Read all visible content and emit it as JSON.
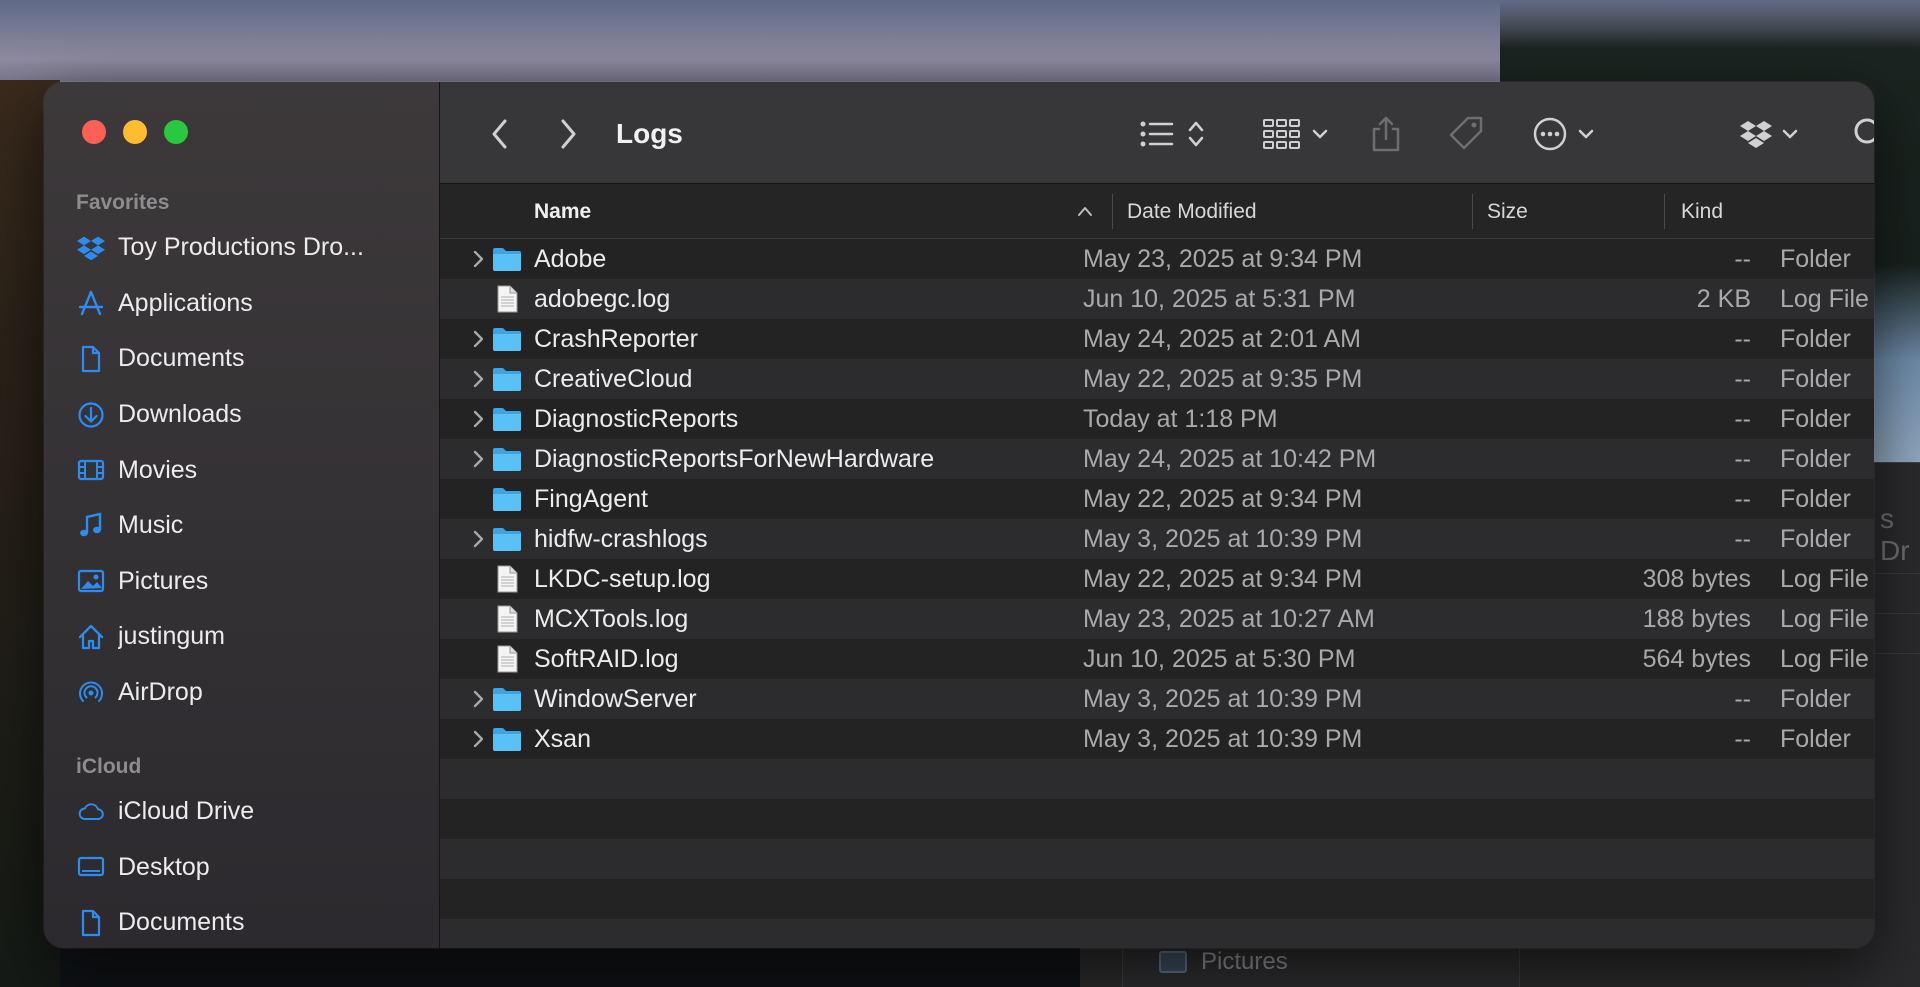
{
  "window": {
    "title": "Logs"
  },
  "sidebar": {
    "favorites_heading": "Favorites",
    "favorites": [
      {
        "label": "Toy Productions Dro...",
        "icon": "dropbox-icon"
      },
      {
        "label": "Applications",
        "icon": "applications-icon"
      },
      {
        "label": "Documents",
        "icon": "document-icon"
      },
      {
        "label": "Downloads",
        "icon": "download-icon"
      },
      {
        "label": "Movies",
        "icon": "film-icon"
      },
      {
        "label": "Music",
        "icon": "music-note-icon"
      },
      {
        "label": "Pictures",
        "icon": "picture-icon"
      },
      {
        "label": "justingum",
        "icon": "home-icon"
      },
      {
        "label": "AirDrop",
        "icon": "airdrop-icon"
      }
    ],
    "icloud_heading": "iCloud",
    "icloud": [
      {
        "label": "iCloud Drive",
        "icon": "cloud-icon"
      },
      {
        "label": "Desktop",
        "icon": "desktop-icon"
      },
      {
        "label": "Documents",
        "icon": "document-icon"
      }
    ]
  },
  "columns": {
    "name": "Name",
    "date_modified": "Date Modified",
    "size": "Size",
    "kind": "Kind"
  },
  "files": [
    {
      "name": "Adobe",
      "date": "May 23, 2025 at 9:34 PM",
      "size": "--",
      "kind": "Folder",
      "type": "folder",
      "expandable": true
    },
    {
      "name": "adobegc.log",
      "date": "Jun 10, 2025 at 5:31 PM",
      "size": "2 KB",
      "kind": "Log File",
      "type": "file",
      "expandable": false
    },
    {
      "name": "CrashReporter",
      "date": "May 24, 2025 at 2:01 AM",
      "size": "--",
      "kind": "Folder",
      "type": "folder",
      "expandable": true
    },
    {
      "name": "CreativeCloud",
      "date": "May 22, 2025 at 9:35 PM",
      "size": "--",
      "kind": "Folder",
      "type": "folder",
      "expandable": true
    },
    {
      "name": "DiagnosticReports",
      "date": "Today at 1:18 PM",
      "size": "--",
      "kind": "Folder",
      "type": "folder",
      "expandable": true
    },
    {
      "name": "DiagnosticReportsForNewHardware",
      "date": "May 24, 2025 at 10:42 PM",
      "size": "--",
      "kind": "Folder",
      "type": "folder",
      "expandable": true
    },
    {
      "name": "FingAgent",
      "date": "May 22, 2025 at 9:34 PM",
      "size": "--",
      "kind": "Folder",
      "type": "folder",
      "expandable": false
    },
    {
      "name": "hidfw-crashlogs",
      "date": "May 3, 2025 at 10:39 PM",
      "size": "--",
      "kind": "Folder",
      "type": "folder",
      "expandable": true
    },
    {
      "name": "LKDC-setup.log",
      "date": "May 22, 2025 at 9:34 PM",
      "size": "308 bytes",
      "kind": "Log File",
      "type": "file",
      "expandable": false
    },
    {
      "name": "MCXTools.log",
      "date": "May 23, 2025 at 10:27 AM",
      "size": "188 bytes",
      "kind": "Log File",
      "type": "file",
      "expandable": false
    },
    {
      "name": "SoftRAID.log",
      "date": "Jun 10, 2025 at 5:30 PM",
      "size": "564 bytes",
      "kind": "Log File",
      "type": "file",
      "expandable": false
    },
    {
      "name": "WindowServer",
      "date": "May 3, 2025 at 10:39 PM",
      "size": "--",
      "kind": "Folder",
      "type": "folder",
      "expandable": true
    },
    {
      "name": "Xsan",
      "date": "May 3, 2025 at 10:39 PM",
      "size": "--",
      "kind": "Folder",
      "type": "folder",
      "expandable": true
    }
  ],
  "background_window": {
    "partial_title": "s Dr",
    "pictures_label": "Pictures"
  },
  "colors": {
    "accent": "#2d8cf0",
    "folder": "#4cb5f5",
    "close": "#fe5f57",
    "minimize": "#febc2e",
    "maximize": "#28c840"
  }
}
